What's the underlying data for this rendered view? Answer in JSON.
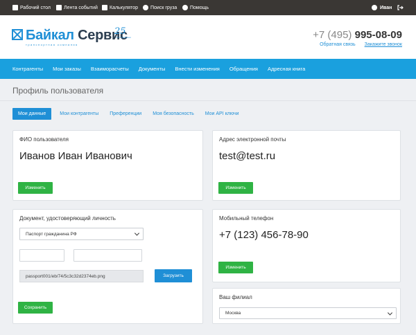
{
  "topbar": {
    "items": [
      "Рабочий стол",
      "Лента событий",
      "Калькулятор",
      "Поиск груза",
      "Помощь"
    ],
    "user": "Иван"
  },
  "header": {
    "logo_part1": "Байкал",
    "logo_part2": "Сервис",
    "logo_sub": "транспортная компания",
    "logo_years": "25",
    "logo_years_sub": "лет в движении",
    "phone_prefix": "+7 (495)",
    "phone_number": "995-08-09",
    "feedback_link": "Обратная связь",
    "callback_link": "Закажите звонок"
  },
  "nav": {
    "items": [
      "Контрагенты",
      "Мои заказы",
      "Взаиморасчеты",
      "Документы",
      "Внести изменения",
      "Обращения",
      "Адресная книга"
    ]
  },
  "page": {
    "title": "Профиль пользователя"
  },
  "tabs": [
    "Мои данные",
    "Мои контрагенты",
    "Преференции",
    "Моя безопасность",
    "Мои API ключи"
  ],
  "cards": {
    "fio": {
      "label": "ФИО пользователя",
      "value": "Иванов Иван Иванович",
      "button": "Изменить"
    },
    "email": {
      "label": "Адрес электронной почты",
      "value": "test@test.ru",
      "button": "Изменить"
    },
    "document": {
      "label": "Документ, удостоверяющий личность",
      "doc_type": "Паспорт гражданина РФ",
      "series_value": "",
      "number_value": "",
      "file_name": "passport001/eb/74/5c3c32d2374eb.png",
      "upload_button": "Загрузить",
      "save_button": "Сохранить"
    },
    "phone": {
      "label": "Мобильный телефон",
      "value": "+7 (123) 456-78-90",
      "button": "Изменить"
    },
    "branch": {
      "label": "Ваш филиал",
      "value": "Москва"
    }
  },
  "colors": {
    "brand_blue": "#1f8fd6",
    "nav_blue": "#1aa0de",
    "green": "#2fb344",
    "topbar": "#3a3734"
  }
}
